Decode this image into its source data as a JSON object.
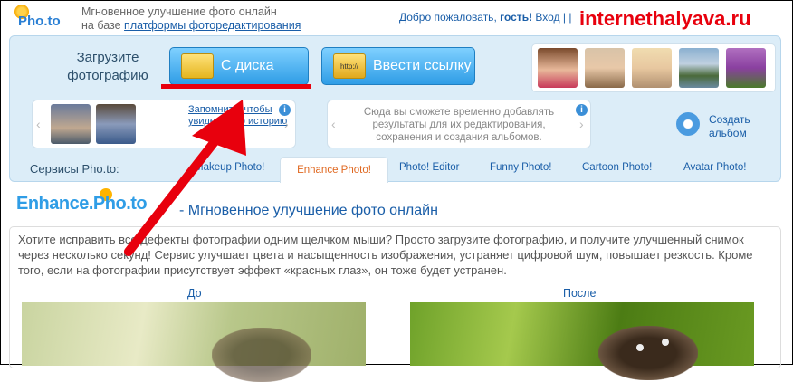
{
  "header": {
    "logo_text": "Pho.to",
    "tagline_line1": "Мгновенное улучшение фото онлайн",
    "tagline_line2_prefix": "на базе",
    "tagline_link": "платформы фоторедактирования",
    "welcome_prefix": "Добро пожаловать,",
    "welcome_guest": "гость!",
    "login": "Вход",
    "separator": "| |",
    "site_watermark": "internethalyava.ru"
  },
  "upload": {
    "label": "Загрузите фотографию",
    "disk_button": "С диска",
    "link_button": "Ввести ссылку",
    "http_icon_text": "http://"
  },
  "recent": {
    "link_text": "Запомнить, чтобы увидеть всю историю",
    "info": "i",
    "arrow_left": "‹",
    "arrow_right": "›"
  },
  "albums": {
    "hint": "Сюда вы сможете временно добавлять результаты для их редактирования, сохранения и создания альбомов.",
    "create_album": "Создать альбом",
    "info": "i"
  },
  "services": {
    "label": "Сервисы Pho.to:",
    "tabs": [
      {
        "label": "Makeup Photo!",
        "active": false
      },
      {
        "label": "Enhance Photo!",
        "active": true
      },
      {
        "label": "Photo! Editor",
        "active": false
      },
      {
        "label": "Funny Photo!",
        "active": false
      },
      {
        "label": "Cartoon Photo!",
        "active": false
      },
      {
        "label": "Avatar Photo!",
        "active": false
      }
    ]
  },
  "main": {
    "product_logo": "Enhance.Pho.to",
    "title": "- Мгновенное улучшение фото онлайн",
    "description": "Хотите исправить все дефекты фотографии одним щелчком мыши? Просто загрузите фотографию, и получите улучшенный снимок через несколько секунд! Сервис улучшает цвета и насыщенность изображения, устраняет цифровой шум, повышает резкость. Кроме того, если на фотографии присутствует эффект «красных глаз», он тоже будет устранен.",
    "before_label": "До",
    "after_label": "После"
  },
  "colors": {
    "accent": "#2f9de6",
    "annotation": "#e8000d",
    "link": "#1a5ea8",
    "active_tab": "#e06820"
  }
}
